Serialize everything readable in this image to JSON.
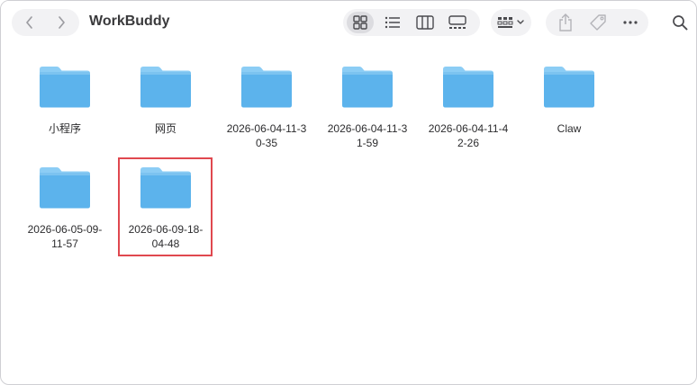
{
  "window": {
    "title": "WorkBuddy",
    "nav": {
      "back_icon": "chevron-left-icon",
      "forward_icon": "chevron-right-icon"
    },
    "toolbar": {
      "view_modes": [
        {
          "icon": "grid-view-icon",
          "selected": true
        },
        {
          "icon": "list-view-icon",
          "selected": false
        },
        {
          "icon": "column-view-icon",
          "selected": false
        },
        {
          "icon": "gallery-view-icon",
          "selected": false
        }
      ],
      "group_icon": "group-by-icon",
      "actions": [
        "share-icon",
        "tag-icon",
        "more-icon"
      ],
      "search_icon": "search-icon"
    }
  },
  "files": [
    {
      "label": "小程序",
      "type": "folder"
    },
    {
      "label": "网页",
      "type": "folder"
    },
    {
      "label": "2026-06-04-11-3\n0-35",
      "type": "folder"
    },
    {
      "label": "2026-06-04-11-3\n1-59",
      "type": "folder"
    },
    {
      "label": "2026-06-04-11-4\n2-26",
      "type": "folder"
    },
    {
      "label": "Claw",
      "type": "folder"
    },
    {
      "label": "2026-06-05-09-\n11-57",
      "type": "folder"
    },
    {
      "label": "2026-06-09-18-\n04-48",
      "type": "folder",
      "highlighted": true
    }
  ],
  "colors": {
    "folder": "#5cb3ec",
    "folder_tab": "#8ccdf5",
    "highlight": "#e0484f",
    "toolbar_bg": "#f2f2f4"
  }
}
